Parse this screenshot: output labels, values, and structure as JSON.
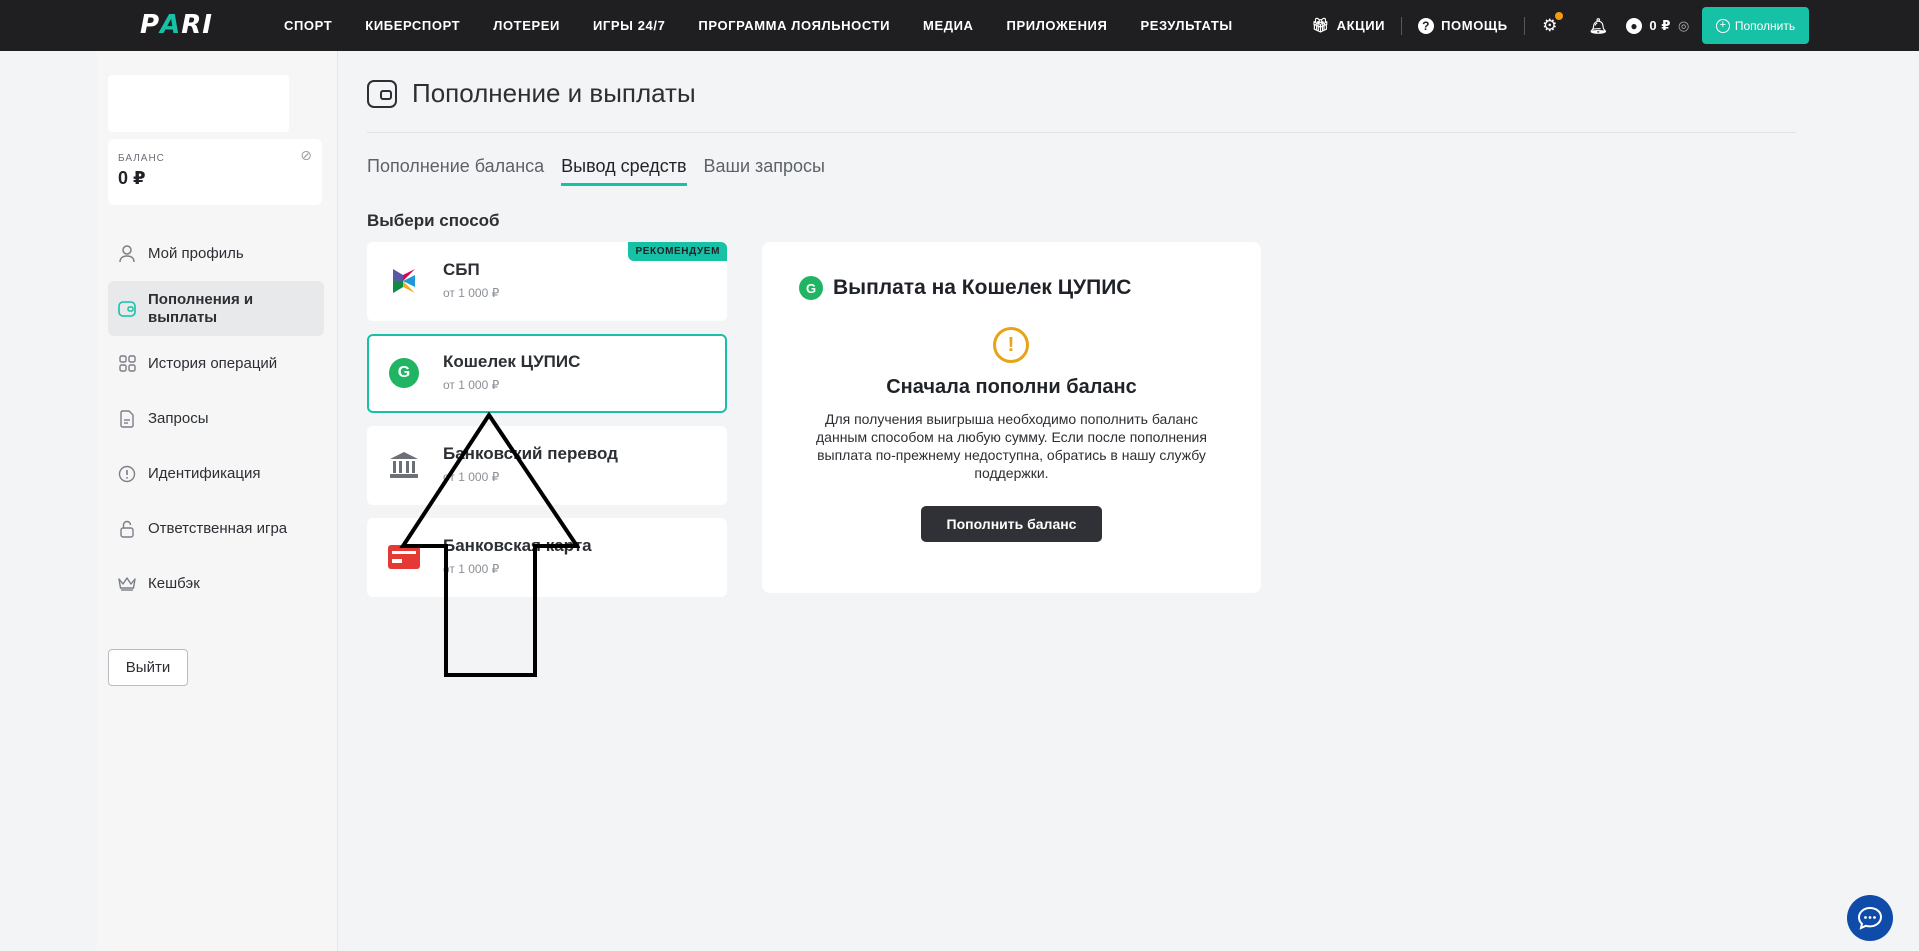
{
  "topbar": {
    "logo": {
      "part1": "P",
      "part2": "A",
      "part3": "RI"
    },
    "nav": [
      "СПОРТ",
      "КИБЕРСПОРТ",
      "ЛОТЕРЕИ",
      "ИГРЫ 24/7",
      "ПРОГРАММА ЛОЯЛЬНОСТИ",
      "МЕДИА",
      "ПРИЛОЖЕНИЯ",
      "РЕЗУЛЬТАТЫ"
    ],
    "promos_label": "АКЦИИ",
    "help_label": "ПОМОЩЬ",
    "balance": "0 ₽",
    "topup_label": "Пополнить"
  },
  "sidebar": {
    "balance_label": "БАЛАНС",
    "balance_value": "0 ₽",
    "items": [
      {
        "label": "Мой профиль",
        "icon": "user-icon"
      },
      {
        "label": "Пополнения и выплаты",
        "icon": "wallet-icon"
      },
      {
        "label": "История операций",
        "icon": "grid-icon"
      },
      {
        "label": "Запросы",
        "icon": "document-icon"
      },
      {
        "label": "Идентификация",
        "icon": "exclamation-icon"
      },
      {
        "label": "Ответственная игра",
        "icon": "lock-icon"
      },
      {
        "label": "Кешбэк",
        "icon": "crown-icon"
      }
    ],
    "logout_label": "Выйти"
  },
  "main": {
    "title": "Пополнение и выплаты",
    "tabs": [
      "Пополнение баланса",
      "Вывод средств",
      "Ваши запросы"
    ],
    "choose_label": "Выбери способ",
    "methods": [
      {
        "name": "СБП",
        "min": "от 1 000 ₽",
        "badge": "РЕКОМЕНДУЕМ"
      },
      {
        "name": "Кошелек ЦУПИС",
        "min": "от 1 000 ₽"
      },
      {
        "name": "Банковский перевод",
        "min": "от 1 000 ₽"
      },
      {
        "name": "Банковская карта",
        "min": "от 1 000 ₽"
      }
    ],
    "panel": {
      "title": "Выплата на Кошелек ЦУПИС",
      "heading": "Сначала пополни баланс",
      "text": "Для получения выигрыша необходимо пополнить баланс данным способом на любую сумму. Если после пополнения выплата по-прежнему недоступна, обратись в нашу службу поддержки.",
      "button": "Пополнить баланс"
    }
  },
  "colors": {
    "accent": "#16c1a6",
    "topbar": "#1f1f22",
    "warning": "#e8a317",
    "chat": "#0f4ba8"
  }
}
